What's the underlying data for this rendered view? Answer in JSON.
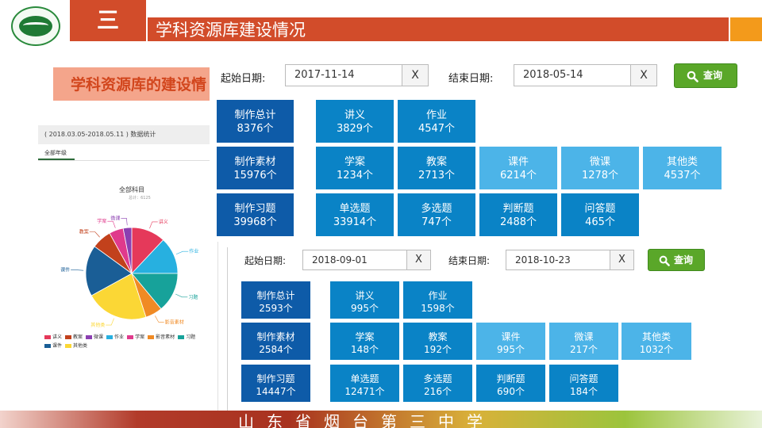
{
  "header": {
    "section_number": "三",
    "title": "学科资源库建设情况",
    "colors": {
      "accent": "#d24c2a",
      "corner": "#f39a1b"
    }
  },
  "subtitle": "学科资源库的建设情",
  "stats_panel": {
    "period": "( 2018.03.05-2018.05.11 ) 数据统计",
    "tab": "全部年级",
    "chart_title": "全部科目",
    "chart_subtitle": "总计：6125",
    "slice_labels": [
      "讲义",
      "作业",
      "习题",
      "影音素材",
      "其他类",
      "课件",
      "教案",
      "学案",
      "微课"
    ],
    "legend": [
      "讲义",
      "教案",
      "微课",
      "作业",
      "学案",
      "影音素材",
      "习题",
      "课件",
      "其他类"
    ]
  },
  "chart_data": {
    "type": "pie",
    "title": "全部科目",
    "subtitle": "总计：6125",
    "slices": [
      {
        "label": "讲义",
        "value": 12,
        "color": "#e5395a"
      },
      {
        "label": "作业",
        "value": 13,
        "color": "#27b0e0"
      },
      {
        "label": "习题",
        "value": 14,
        "color": "#17a29a"
      },
      {
        "label": "影音素材",
        "value": 6,
        "color": "#f08a24"
      },
      {
        "label": "其他类",
        "value": 22,
        "color": "#fbd735"
      },
      {
        "label": "课件",
        "value": 18,
        "color": "#1a5e96"
      },
      {
        "label": "教案",
        "value": 7,
        "color": "#c2411c"
      },
      {
        "label": "学案",
        "value": 5,
        "color": "#e03a8c"
      },
      {
        "label": "微课",
        "value": 3,
        "color": "#8b3fb1"
      }
    ]
  },
  "query1": {
    "start_label": "起始日期:",
    "start_value": "2017-11-14",
    "end_label": "结束日期:",
    "end_value": "2018-05-14",
    "clear": "X",
    "button": "查询",
    "tiles": {
      "total": {
        "label": "制作总计",
        "value": "8376个"
      },
      "handout": {
        "label": "讲义",
        "value": "3829个"
      },
      "homework": {
        "label": "作业",
        "value": "4547个"
      },
      "material": {
        "label": "制作素材",
        "value": "15976个"
      },
      "study_plan": {
        "label": "学案",
        "value": "1234个"
      },
      "teaching_plan": {
        "label": "教案",
        "value": "2713个"
      },
      "courseware": {
        "label": "课件",
        "value": "6214个"
      },
      "micro_course": {
        "label": "微课",
        "value": "1278个"
      },
      "other": {
        "label": "其他类",
        "value": "4537个"
      },
      "exercise": {
        "label": "制作习题",
        "value": "39968个"
      },
      "single_choice": {
        "label": "单选题",
        "value": "33914个"
      },
      "multi_choice": {
        "label": "多选题",
        "value": "747个"
      },
      "true_false": {
        "label": "判断题",
        "value": "2488个"
      },
      "qa": {
        "label": "问答题",
        "value": "465个"
      }
    }
  },
  "query2": {
    "start_label": "起始日期:",
    "start_value": "2018-09-01",
    "end_label": "结束日期:",
    "end_value": "2018-10-23",
    "clear": "X",
    "button": "查询",
    "tiles": {
      "total": {
        "label": "制作总计",
        "value": "2593个"
      },
      "handout": {
        "label": "讲义",
        "value": "995个"
      },
      "homework": {
        "label": "作业",
        "value": "1598个"
      },
      "material": {
        "label": "制作素材",
        "value": "2584个"
      },
      "study_plan": {
        "label": "学案",
        "value": "148个"
      },
      "teaching_plan": {
        "label": "教案",
        "value": "192个"
      },
      "courseware": {
        "label": "课件",
        "value": "995个"
      },
      "micro_course": {
        "label": "微课",
        "value": "217个"
      },
      "other": {
        "label": "其他类",
        "value": "1032个"
      },
      "exercise": {
        "label": "制作习题",
        "value": "14447个"
      },
      "single_choice": {
        "label": "单选题",
        "value": "12471个"
      },
      "multi_choice": {
        "label": "多选题",
        "value": "216个"
      },
      "true_false": {
        "label": "判断题",
        "value": "690个"
      },
      "qa": {
        "label": "问答题",
        "value": "184个"
      }
    }
  },
  "footer": {
    "school_name": "山东省烟台第三中学"
  }
}
